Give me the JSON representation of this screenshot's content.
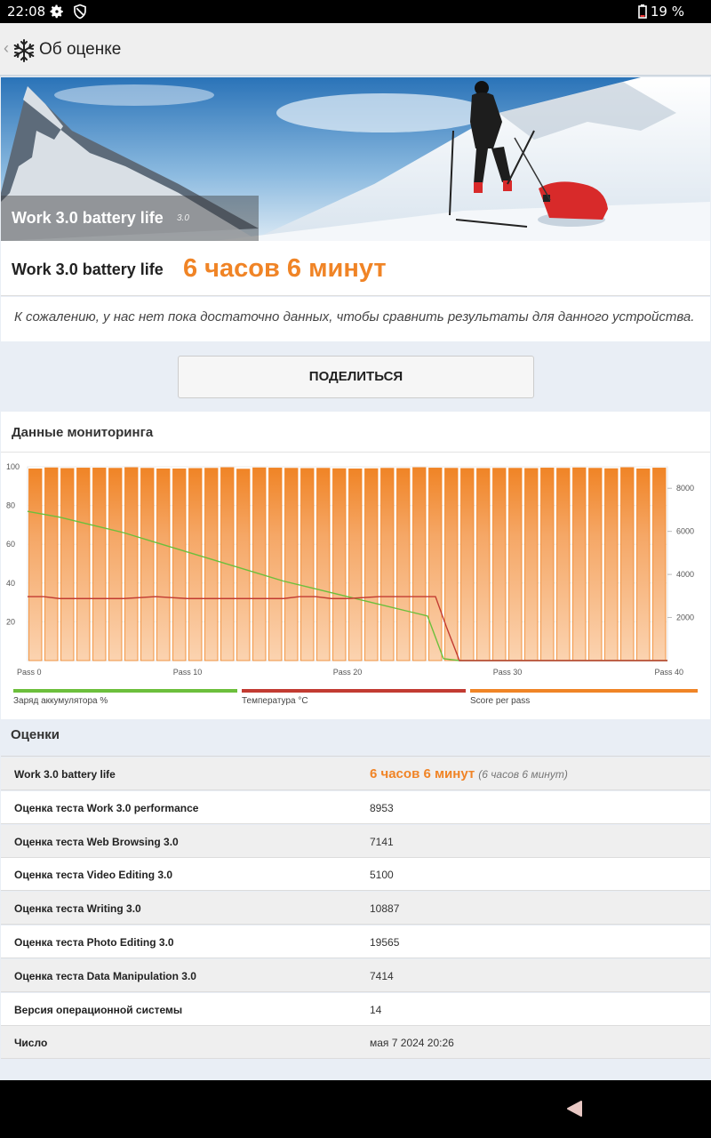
{
  "status": {
    "time": "22:08",
    "battery": "19 %"
  },
  "appbar": {
    "back": "‹",
    "title": "Об оценке",
    "icon": "snowflake-icon"
  },
  "hero": {
    "title": "Work 3.0 battery life",
    "version": "3.0"
  },
  "result": {
    "label": "Work 3.0 battery life",
    "value": "6 часов 6 минут"
  },
  "note": "К сожалению, у нас нет пока достаточно данных, чтобы сравнить результаты для данного устройства.",
  "share_label": "ПОДЕЛИТЬСЯ",
  "monitor": {
    "title": "Данные мониторинга",
    "legend": [
      {
        "label": "Заряд аккумулятора %",
        "color": "#6cbf3c"
      },
      {
        "label": "Температура °C",
        "color": "#c23b32"
      },
      {
        "label": "Score per pass",
        "color": "#f08426"
      }
    ]
  },
  "chart_data": {
    "type": "bar",
    "x_ticks": [
      "Pass 0",
      "Pass 10",
      "Pass 20",
      "Pass 30",
      "Pass 40"
    ],
    "y_left_ticks": [
      "100",
      "80",
      "60",
      "40",
      "20"
    ],
    "y_right_ticks": [
      "8000",
      "6000",
      "4000",
      "2000"
    ],
    "ylim_left": [
      0,
      100
    ],
    "ylim_right": [
      0,
      9000
    ],
    "xlim": [
      0,
      40
    ],
    "series": [
      {
        "name": "Score per pass",
        "axis": "right",
        "values": [
          8900,
          8950,
          8920,
          8940,
          8940,
          8930,
          8960,
          8930,
          8900,
          8900,
          8920,
          8930,
          8960,
          8890,
          8950,
          8940,
          8930,
          8920,
          8930,
          8910,
          8900,
          8910,
          8930,
          8920,
          8960,
          8940,
          8930,
          8920,
          8920,
          8930,
          8930,
          8920,
          8940,
          8930,
          8950,
          8930,
          8910,
          8960,
          8900,
          8940
        ]
      },
      {
        "name": "Заряд аккумулятора %",
        "axis": "left",
        "x": [
          0,
          2,
          4,
          6,
          8,
          10,
          12,
          14,
          16,
          18,
          20,
          22,
          24,
          25,
          26,
          27,
          28,
          30,
          32,
          34,
          36,
          38,
          40
        ],
        "values": [
          77,
          74,
          70,
          66,
          61,
          56,
          51,
          46,
          41,
          37,
          33,
          29,
          25,
          23,
          1,
          0,
          0,
          0,
          0,
          0,
          0,
          0,
          0
        ]
      },
      {
        "name": "Температура °C",
        "axis": "left",
        "x": [
          0,
          1,
          2,
          4,
          6,
          8,
          10,
          12,
          14,
          16,
          17,
          18,
          19,
          20,
          22,
          24,
          25.5,
          26.2,
          27,
          28,
          30,
          32,
          34,
          36,
          38,
          40
        ],
        "values": [
          33,
          33,
          32,
          32,
          32,
          33,
          32,
          32,
          32,
          32,
          33,
          33,
          32,
          32,
          33,
          33,
          33,
          17,
          0,
          0,
          0,
          0,
          0,
          0,
          0,
          0
        ]
      }
    ]
  },
  "scores": {
    "title": "Оценки",
    "rows": [
      {
        "label": "Work 3.0 battery life",
        "value": "6 часов 6 минут",
        "sub": "(6 часов 6 минут)"
      },
      {
        "label": "Оценка теста Work 3.0 performance",
        "value": "8953"
      },
      {
        "label": "Оценка теста Web Browsing 3.0",
        "value": "7141"
      },
      {
        "label": "Оценка теста Video Editing 3.0",
        "value": "5100"
      },
      {
        "label": "Оценка теста Writing 3.0",
        "value": "10887"
      },
      {
        "label": "Оценка теста Photo Editing 3.0",
        "value": "19565"
      },
      {
        "label": "Оценка теста Data Manipulation 3.0",
        "value": "7414"
      },
      {
        "label": "Версия операционной системы",
        "value": "14"
      },
      {
        "label": "Число",
        "value": "мая 7 2024 20:26"
      }
    ]
  }
}
